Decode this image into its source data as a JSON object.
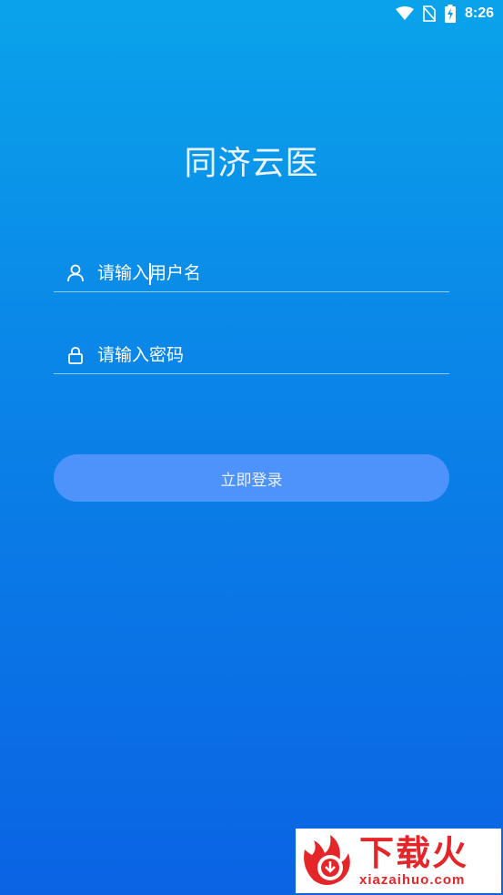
{
  "status_bar": {
    "time": "8:26",
    "icons": [
      "wifi-icon",
      "no-sim-icon",
      "battery-charging-icon"
    ]
  },
  "app": {
    "title": "同济云医"
  },
  "form": {
    "username_placeholder": "请输入用户名",
    "username_value": "",
    "password_placeholder": "请输入密码",
    "password_value": "",
    "username_icon": "user-icon",
    "password_icon": "lock-icon"
  },
  "actions": {
    "login_label": "立即登录"
  },
  "watermark": {
    "main": "下载火",
    "url": "xiazaihuo.com"
  },
  "colors": {
    "gradient_top": "#0aa3ea",
    "gradient_bottom": "#0a63e3",
    "button": "#4d93fb",
    "watermark_red": "#e4262a"
  }
}
